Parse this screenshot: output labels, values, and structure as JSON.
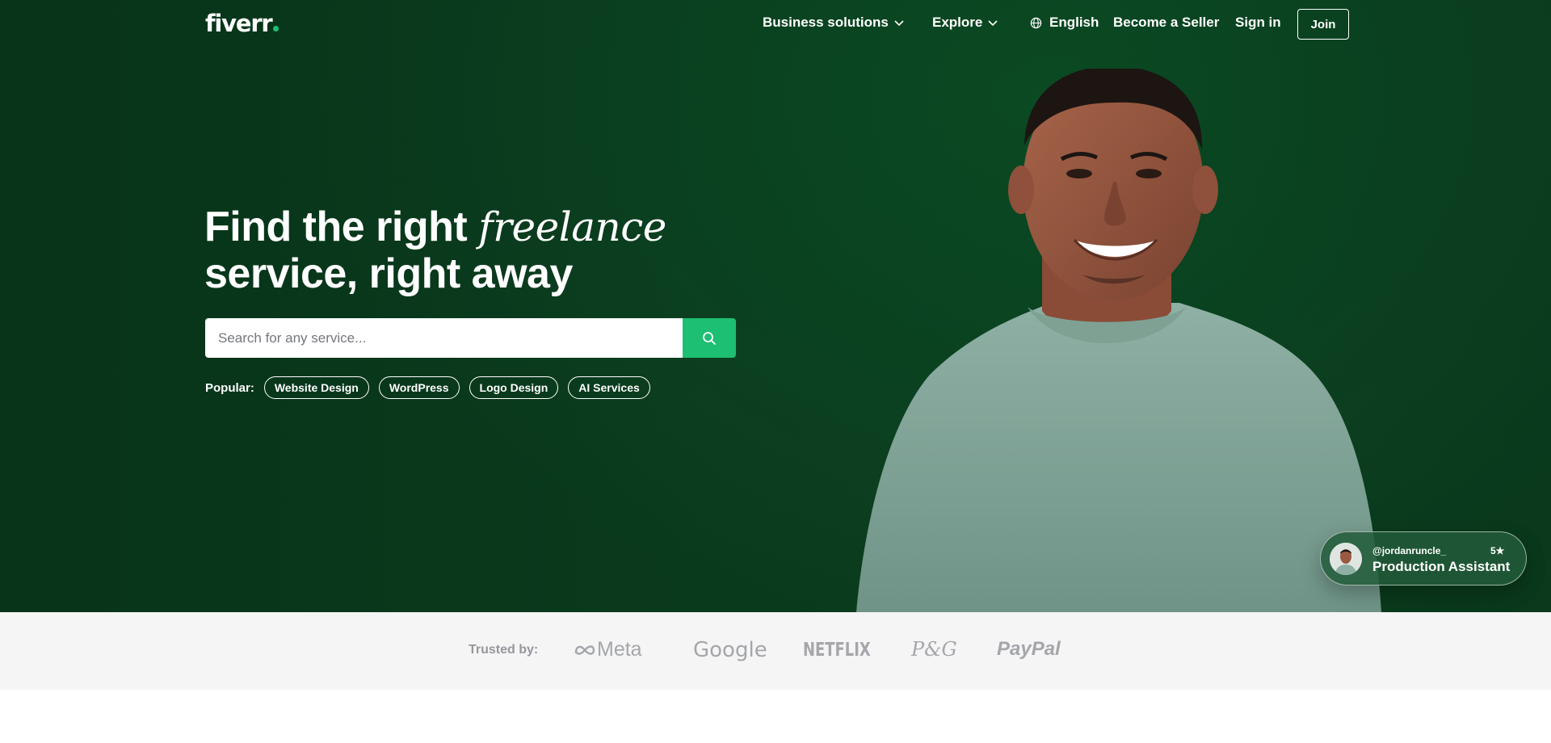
{
  "header": {
    "logo": "fiverr",
    "nav": [
      {
        "label": "Business solutions",
        "has_chevron": true
      },
      {
        "label": "Explore",
        "has_chevron": true
      },
      {
        "label": "English",
        "icon": "globe-icon"
      },
      {
        "label": "Become a Seller"
      },
      {
        "label": "Sign in"
      }
    ],
    "join_label": "Join"
  },
  "hero": {
    "headline_part1": "Find the right ",
    "headline_italic": "freelance",
    "headline_part2": "service, right away",
    "search_placeholder": "Search for any service...",
    "search_icon": "search-icon",
    "popular_label": "Popular:",
    "popular_items": [
      "Website Design",
      "WordPress",
      "Logo Design",
      "AI Services"
    ]
  },
  "seller_card": {
    "handle": "@jordanruncle_",
    "rating": "5★",
    "title": "Production Assistant"
  },
  "trusted": {
    "label": "Trusted by:",
    "brands": [
      "Meta",
      "Google",
      "NETFLIX",
      "P&G",
      "PayPal"
    ]
  },
  "colors": {
    "hero_bg": "#0a4421",
    "accent": "#1dbf73",
    "trusted_bg": "#f5f5f5"
  }
}
